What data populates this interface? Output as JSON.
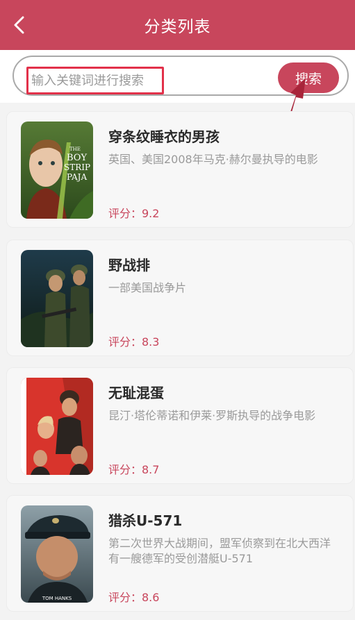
{
  "header": {
    "title": "分类列表"
  },
  "search": {
    "placeholder": "输入关键词进行搜索",
    "button_label": "搜索"
  },
  "movies": [
    {
      "title": "穿条纹睡衣的男孩",
      "description": "英国、美国2008年马克·赫尔曼执导的电影",
      "score": "评分：9.2"
    },
    {
      "title": "野战排",
      "description": "一部美国战争片",
      "score": "评分：8.3"
    },
    {
      "title": "无耻混蛋",
      "description": "昆汀·塔伦蒂诺和伊莱·罗斯执导的战争电影",
      "score": "评分：8.7"
    },
    {
      "title": "猎杀U-571",
      "description": "第二次世界大战期间，盟军侦察到在北大西洋有一艘德军的受创潜艇U-571",
      "score": "评分：8.6"
    }
  ],
  "posters": [
    {
      "text_lines": [
        "THE",
        "BOY",
        "STRIP",
        "PAJA"
      ]
    },
    {},
    {},
    {
      "text": "TOM HANKS"
    }
  ],
  "colors": {
    "brand": "#c8465c",
    "highlight": "#e2314a",
    "arrow": "#a8253a"
  }
}
